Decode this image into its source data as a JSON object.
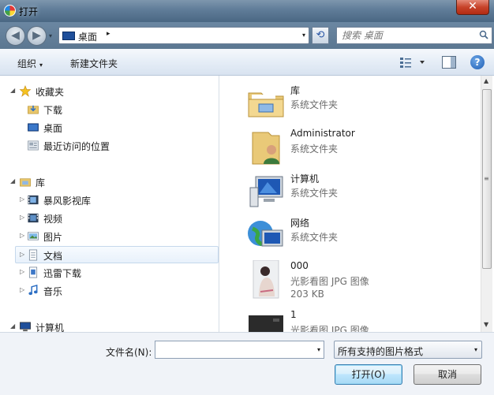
{
  "window": {
    "title": "打开",
    "close_glyph": "✕"
  },
  "navigation": {
    "back_glyph": "◀",
    "forward_glyph": "▶",
    "dropdown_glyph": "▾"
  },
  "address": {
    "location": "桌面",
    "separator": "▸",
    "refresh_glyph": "⟲"
  },
  "search": {
    "placeholder": "搜索 桌面"
  },
  "toolbar": {
    "organize": "组织",
    "new_folder": "新建文件夹",
    "help_glyph": "?"
  },
  "sidebar": {
    "favorites": {
      "label": "收藏夹",
      "items": [
        {
          "label": "下载",
          "icon": "download-folder-icon"
        },
        {
          "label": "桌面",
          "icon": "desktop-icon"
        },
        {
          "label": "最近访问的位置",
          "icon": "recent-places-icon"
        }
      ]
    },
    "libraries": {
      "label": "库",
      "items": [
        {
          "label": "暴风影视库",
          "icon": "video-library-icon"
        },
        {
          "label": "视频",
          "icon": "video-icon"
        },
        {
          "label": "图片",
          "icon": "pictures-icon"
        },
        {
          "label": "文档",
          "icon": "documents-icon",
          "selected": true
        },
        {
          "label": "迅雷下载",
          "icon": "thunder-download-icon"
        },
        {
          "label": "音乐",
          "icon": "music-icon"
        }
      ]
    },
    "computer": {
      "label": "计算机"
    }
  },
  "files": [
    {
      "name": "库",
      "type": "系统文件夹",
      "icon": "library-folder-icon"
    },
    {
      "name": "Administrator",
      "type": "系统文件夹",
      "icon": "user-folder-icon"
    },
    {
      "name": "计算机",
      "type": "系统文件夹",
      "icon": "computer-icon"
    },
    {
      "name": "网络",
      "type": "系统文件夹",
      "icon": "network-icon"
    },
    {
      "name": "000",
      "type": "光影看图 JPG 图像",
      "size": "203 KB",
      "icon": "photo-thumbnail-icon"
    },
    {
      "name": "1",
      "type": "光影看图 JPG 图像",
      "icon": "dark-thumbnail-icon"
    }
  ],
  "footer": {
    "filename_label": "文件名(N):",
    "filename_value": "",
    "filter_value": "所有支持的图片格式",
    "open_label": "打开(O)",
    "cancel_label": "取消"
  },
  "colors": {
    "titlebar": "#5f7c98",
    "toolbar": "#e4ecf6",
    "selection": "#e8f1fb",
    "accent": "#1f5fb5"
  }
}
